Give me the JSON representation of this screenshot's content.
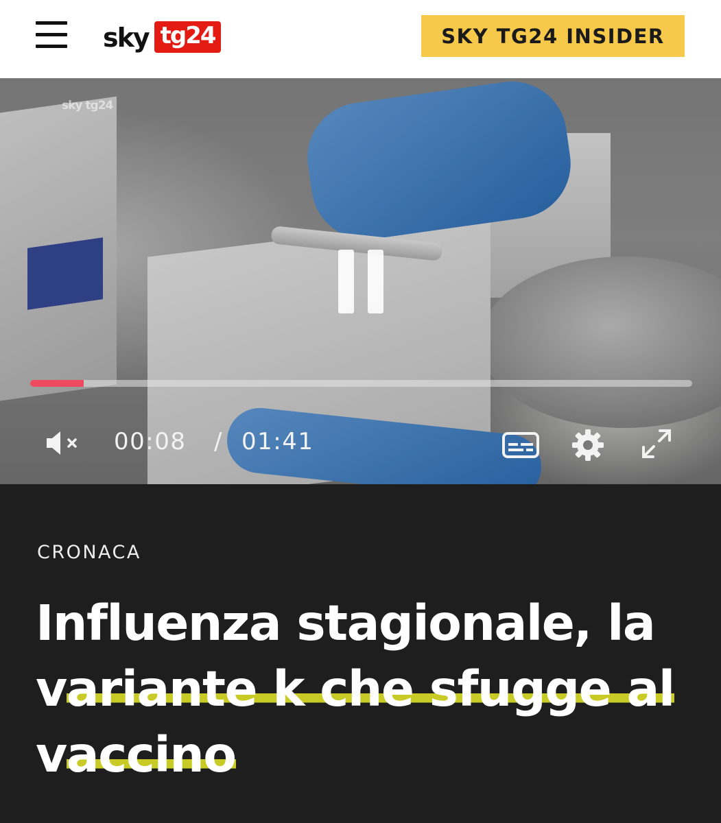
{
  "header": {
    "logo_sky": "sky",
    "logo_tg": "tg24",
    "insider_label": "SKY TG24 INSIDER"
  },
  "video": {
    "watermark": "sky tg24",
    "current_time": "00:08",
    "separator": "/",
    "duration": "01:41",
    "progress_fraction": 0.081,
    "muted": true
  },
  "article": {
    "category": "CRONACA",
    "headline_parts": [
      "Influenza stagionale, la v",
      "ariante k che sfugge al",
      " v",
      "accino"
    ]
  },
  "colors": {
    "brand_red": "#e41b13",
    "insider_yellow": "#f6c94b",
    "progress": "#ee4a5f",
    "highlight": "#e6e828",
    "article_bg": "#1e1e1e"
  }
}
